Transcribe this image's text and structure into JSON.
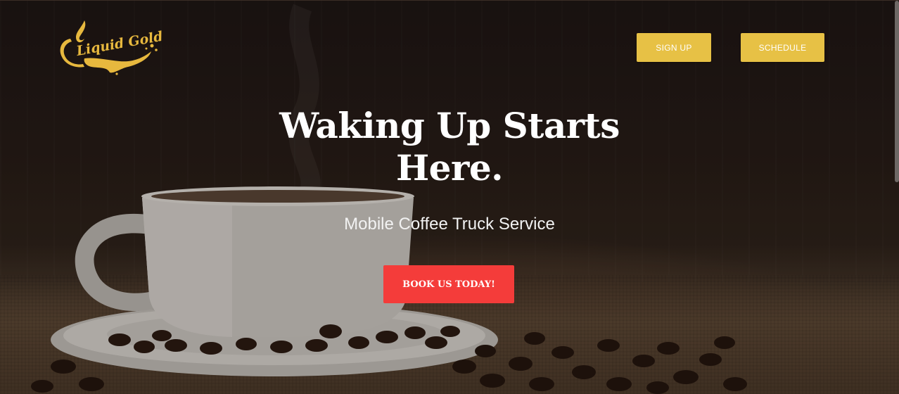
{
  "brand": {
    "logo_text": "Liquid Gold",
    "logo_color": "#e7b83e"
  },
  "nav": {
    "signup_label": "SIGN UP",
    "schedule_label": "SCHEDULE",
    "button_color": "#e7c145"
  },
  "hero": {
    "headline": "Waking Up Starts Here.",
    "subheadline": "Mobile Coffee Truck Service",
    "cta_label": "BOOK US TODAY!",
    "cta_color": "#f43c3a"
  }
}
